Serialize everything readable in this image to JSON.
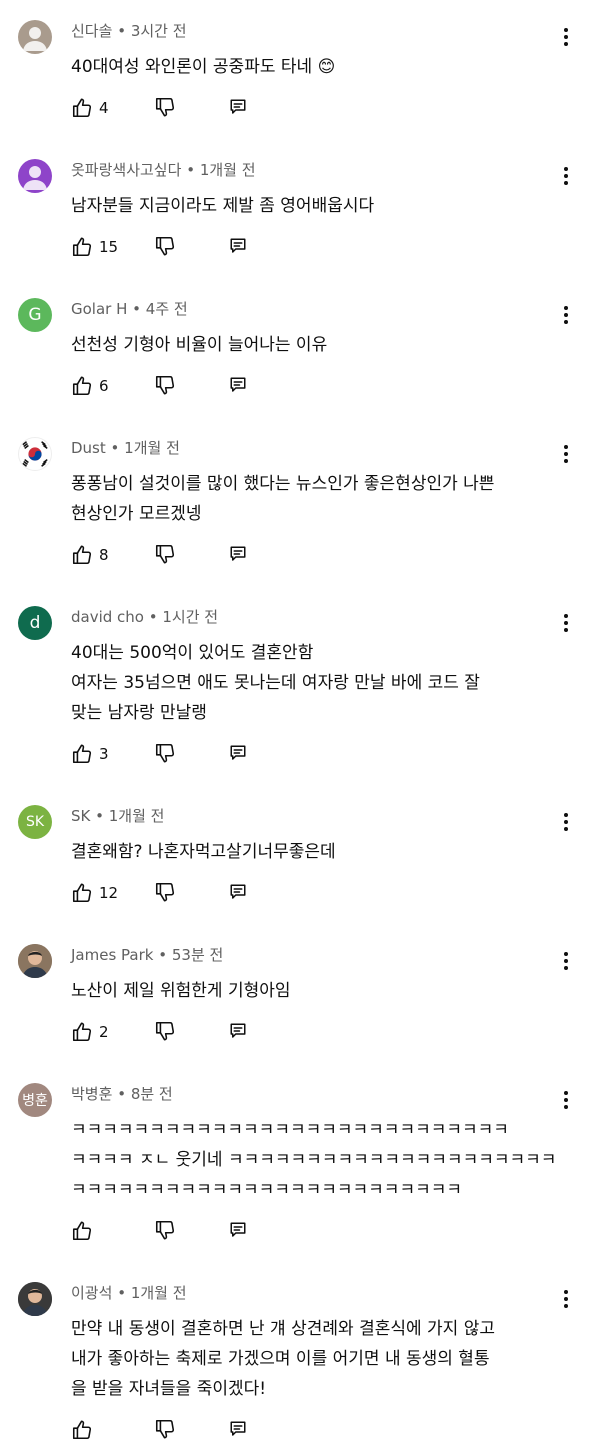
{
  "comments": [
    {
      "author": "신다솔",
      "time": "3시간 전",
      "lines": [
        "40대여성 와인론이 공중파도 타네 😊"
      ],
      "likes": "4",
      "avatar": {
        "kind": "generic",
        "bg": "#a99b8d"
      }
    },
    {
      "author": "옷파랑색사고싶다",
      "time": "1개월 전",
      "lines": [
        "남자분들 지금이라도 제발 좀 영어배웁시다"
      ],
      "likes": "15",
      "avatar": {
        "kind": "generic",
        "bg": "#8e44c9"
      }
    },
    {
      "author": "Golar H",
      "time": "4주 전",
      "lines": [
        "선천성 기형아 비율이 늘어나는 이유"
      ],
      "likes": "6",
      "avatar": {
        "kind": "letter",
        "letter": "G",
        "bg": "#5cb85c"
      }
    },
    {
      "author": "Dust",
      "time": "1개월 전",
      "lines": [
        "퐁퐁남이 설것이를 많이 했다는 뉴스인가 좋은현상인가 나쁜",
        "현상인가 모르겠넹"
      ],
      "likes": "8",
      "avatar": {
        "kind": "flag"
      }
    },
    {
      "author": "david cho",
      "time": "1시간 전",
      "lines": [
        "40대는 500억이 있어도 결혼안함",
        "여자는 35넘으면 애도 못나는데 여자랑 만날 바에 코드 잘",
        "맞는 남자랑 만날랭"
      ],
      "likes": "3",
      "avatar": {
        "kind": "letter",
        "letter": "d",
        "bg": "#0f6b4e"
      }
    },
    {
      "author": "SK",
      "time": "1개월 전",
      "lines": [
        "결혼왜함? 나혼자먹고살기너무좋은데"
      ],
      "likes": "12",
      "avatar": {
        "kind": "letter",
        "letter": "SK",
        "bg": "#7cb342"
      }
    },
    {
      "author": "James Park",
      "time": "53분 전",
      "lines": [
        "노산이 제일 위험한게 기형아임"
      ],
      "likes": "2",
      "avatar": {
        "kind": "photo",
        "bg": "#8a7560"
      }
    },
    {
      "author": "박병훈",
      "time": "8분 전",
      "lines": [
        "ㅋㅋㅋㅋㅋㅋㅋㅋㅋㅋㅋㅋㅋㅋㅋㅋㅋㅋㅋㅋㅋㅋㅋㅋㅋㅋㅋㅋ",
        "ㅋㅋㅋㅋ ㅈㄴ 웃기네 ㅋㅋㅋㅋㅋㅋㅋㅋㅋㅋㅋㅋㅋㅋㅋㅋㅋㅋㅋㅋㅋ",
        "ㅋㅋㅋㅋㅋㅋㅋㅋㅋㅋㅋㅋㅋㅋㅋㅋㅋㅋㅋㅋㅋㅋㅋㅋㅋ"
      ],
      "likes": "",
      "avatar": {
        "kind": "letter",
        "letter": "병훈",
        "bg": "#a1887f"
      }
    },
    {
      "author": "이광석",
      "time": "1개월 전",
      "lines": [
        "만약 내 동생이 결혼하면 난 걔 상견례와 결혼식에 가지 않고",
        "내가 좋아하는 축제로 가겠으며 이를 어기면 내 동생의 혈통",
        "을 받을 자녀들을 죽이겠다!"
      ],
      "likes": "",
      "avatar": {
        "kind": "photo",
        "bg": "#3a3a3a"
      }
    }
  ]
}
